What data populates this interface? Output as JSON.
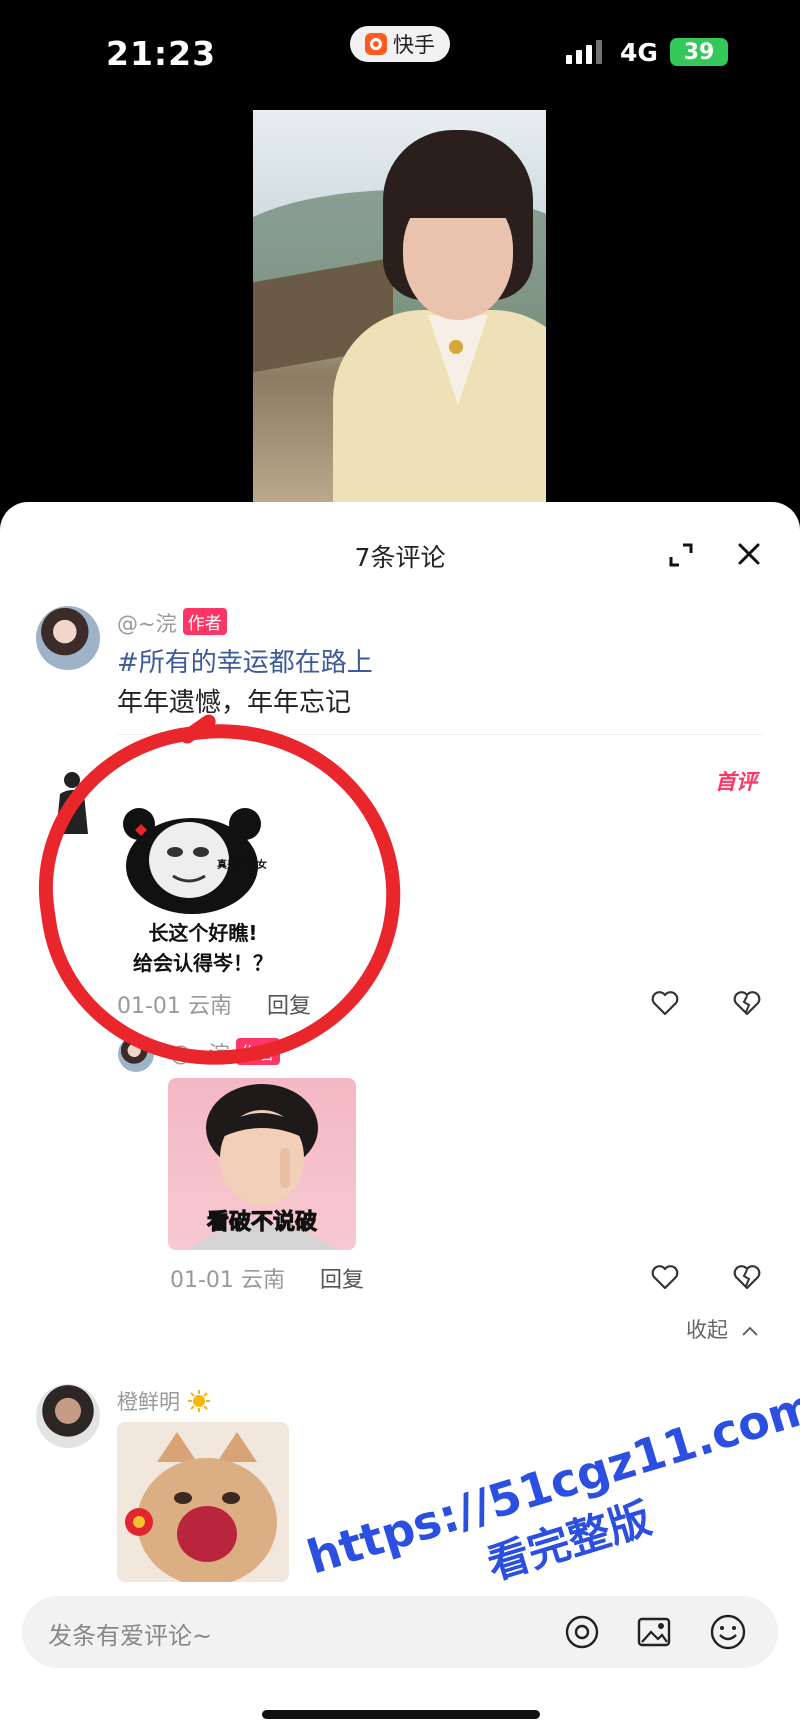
{
  "status_bar": {
    "time": "21:23",
    "app_name": "快手",
    "network": "4G",
    "battery": "39"
  },
  "comments_panel": {
    "title": "7条评论",
    "author_comment": {
      "username": "@~浣",
      "author_tag": "作者",
      "topic": "#所有的幸运都在路上",
      "text": "年年遗憾，年年忘记"
    },
    "first_comment": {
      "badge": "首评",
      "sticker_text": "真是个美女!",
      "sticker_caption_line1": "长这个好瞧!",
      "sticker_caption_line2": "给会认得岑！？",
      "date": "01-01",
      "location": "云南",
      "reply_label": "回复"
    },
    "reply": {
      "username": "@~浣",
      "author_tag": "作者",
      "sticker_text": "看破不说破",
      "date": "01-01",
      "location": "云南",
      "reply_label": "回复"
    },
    "collapse_label": "收起",
    "third_comment": {
      "username": "橙鲜明"
    }
  },
  "input_bar": {
    "placeholder": "发条有爱评论~"
  },
  "watermark": {
    "line1": "https://51cgz11.com",
    "line2": "看完整版"
  },
  "colors": {
    "accent": "#fe3666",
    "annotation": "#e8262b",
    "watermark": "#2b4fe0"
  }
}
